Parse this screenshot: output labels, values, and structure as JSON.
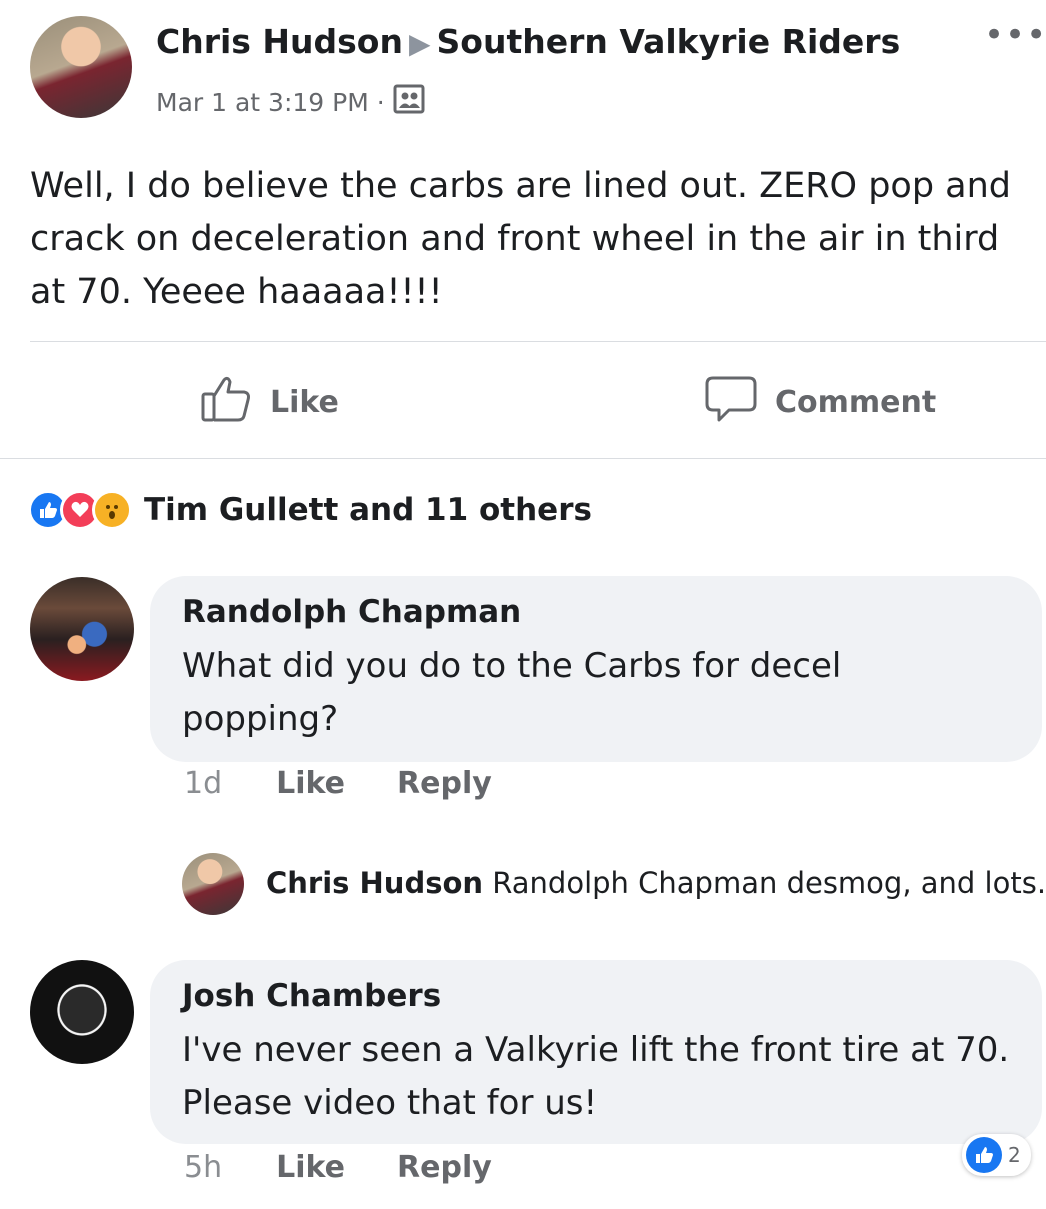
{
  "post": {
    "author": "Chris Hudson",
    "group": "Southern Valkyrie Riders",
    "timestamp": "Mar 1 at 3:19 PM",
    "separator": "·",
    "privacy_icon": "group-icon",
    "more_icon": "ellipsis-icon",
    "text": "Well, I do believe the carbs are lined out. ZERO pop and crack on deceleration and front wheel in the air in third at 70. Yeeee haaaaa!!!!"
  },
  "actions": {
    "like_label": "Like",
    "comment_label": "Comment"
  },
  "reactions": {
    "summary": "Tim Gullett and 11 others",
    "types": [
      "like",
      "love",
      "wow"
    ]
  },
  "comments": [
    {
      "author": "Randolph Chapman",
      "text": "What did you do to the Carbs for decel popping?",
      "time": "1d",
      "like_label": "Like",
      "reply_label": "Reply"
    },
    {
      "author": "Josh Chambers",
      "text": "I've never seen a Valkyrie lift the front tire at 70. Please video that for us!",
      "time": "5h",
      "like_label": "Like",
      "reply_label": "Reply",
      "like_count": "2"
    }
  ],
  "reply_preview": {
    "author": "Chris Hudson",
    "text": "Randolph Chapman desmog, and lots..."
  },
  "colors": {
    "facebook_blue": "#1877f2",
    "love_red": "#f33e58",
    "wow_yellow": "#f7b125",
    "bubble_gray": "#f0f2f5",
    "secondary_text": "#65676b"
  }
}
